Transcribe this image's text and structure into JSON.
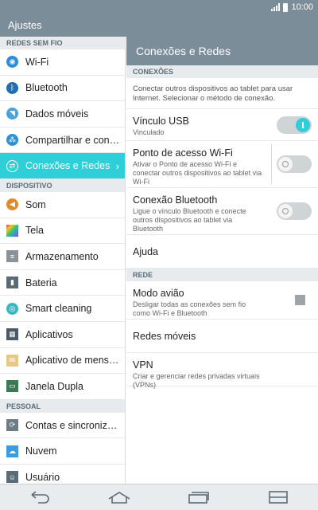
{
  "status": {
    "time": "10:00"
  },
  "app": {
    "title": "Ajustes"
  },
  "left": {
    "sections": [
      {
        "label": "REDES SEM FIO",
        "items": [
          {
            "label": "Wi-Fi",
            "icon": "wifi-icon",
            "color": "#2a8fd6"
          },
          {
            "label": "Bluetooth",
            "icon": "bluetooth-icon",
            "color": "#1f6fb5"
          },
          {
            "label": "Dados móveis",
            "icon": "mobile-data-icon",
            "color": "#4aa3df"
          },
          {
            "label": "Compartilhar e con…",
            "icon": "share-icon",
            "color": "#2f8fd1"
          },
          {
            "label": "Conexões e Redes",
            "icon": "connections-icon",
            "color": "#2ecfd9",
            "active": true
          }
        ]
      },
      {
        "label": "DISPOSITIVO",
        "items": [
          {
            "label": "Som",
            "icon": "sound-icon",
            "color": "#e08a2b"
          },
          {
            "label": "Tela",
            "icon": "display-icon",
            "color": "#8a4bd1"
          },
          {
            "label": "Armazenamento",
            "icon": "storage-icon",
            "color": "#8c9398"
          },
          {
            "label": "Bateria",
            "icon": "battery-icon",
            "color": "#5c6a74"
          },
          {
            "label": "Smart cleaning",
            "icon": "smart-cleaning-icon",
            "color": "#37b6c4"
          },
          {
            "label": "Aplicativos",
            "icon": "apps-icon",
            "color": "#4b5a66"
          },
          {
            "label": "Aplicativo de mens…",
            "icon": "messaging-icon",
            "color": "#e6c98a"
          },
          {
            "label": "Janela Dupla",
            "icon": "dual-window-icon",
            "color": "#3a7a55"
          }
        ]
      },
      {
        "label": "PESSOAL",
        "items": [
          {
            "label": "Contas e sincroniza…",
            "icon": "accounts-icon",
            "color": "#6f7c86"
          },
          {
            "label": "Nuvem",
            "icon": "cloud-icon",
            "color": "#3d9be0"
          },
          {
            "label": "Usuário",
            "icon": "user-icon",
            "color": "#5b6b77"
          }
        ]
      }
    ]
  },
  "right": {
    "title": "Conexões e Redes",
    "sec_conexoes": "CONEXÕES",
    "desc": "Conectar outros dispositivos ao tablet para usar Internet. Selecionar o método de conexão.",
    "usb_title": "Vínculo USB",
    "usb_sub": "Vinculado",
    "hotspot_title": "Ponto de acesso Wi-Fi",
    "hotspot_sub": "Ativar o Ponto de acesso Wi-Fi e conectar outros dispositivos ao tablet via Wi-Fi",
    "bt_title": "Conexão Bluetooth",
    "bt_sub": "Ligue o vínculo Bluetooth e conecte outros dispositivos ao tablet via Bluetooth",
    "help": "Ajuda",
    "sec_rede": "REDE",
    "airplane_title": "Modo avião",
    "airplane_sub": "Desligar todas as conexões sem fio como Wi-Fi e Bluetooth",
    "mobile_networks": "Redes móveis",
    "vpn_title": "VPN",
    "vpn_sub": "Criar e gerenciar redes privadas virtuais (VPNs)"
  },
  "accent_color": "#2ecfd9"
}
